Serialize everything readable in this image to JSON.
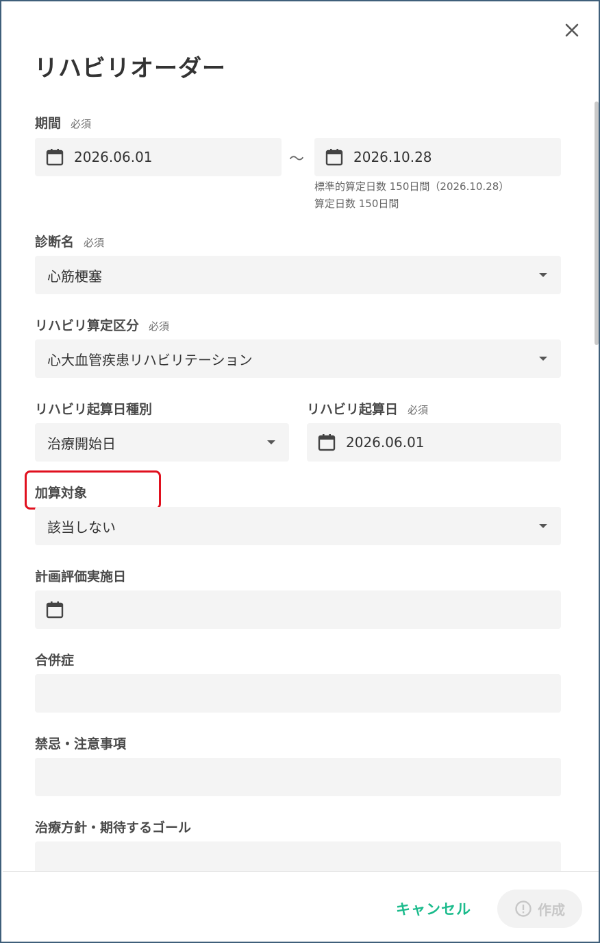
{
  "dialog": {
    "title": "リハビリオーダー",
    "close_icon": "close-icon"
  },
  "form": {
    "required_label": "必須",
    "period": {
      "label": "期間",
      "start": "2026.06.01",
      "separator": "～",
      "end": "2026.10.28",
      "standard_days_note": "標準的算定日数 150日間（2026.10.28）",
      "calc_days_note": "算定日数 150日間"
    },
    "diagnosis": {
      "label": "診断名",
      "value": "心筋梗塞"
    },
    "rehab_category": {
      "label": "リハビリ算定区分",
      "value": "心大血管疾患リハビリテーション"
    },
    "start_type": {
      "label": "リハビリ起算日種別",
      "value": "治療開始日"
    },
    "start_date": {
      "label": "リハビリ起算日",
      "value": "2026.06.01"
    },
    "addition_target": {
      "label": "加算対象",
      "value": "該当しない"
    },
    "plan_eval_date": {
      "label": "計画評価実施日",
      "value": ""
    },
    "complications": {
      "label": "合併症",
      "value": ""
    },
    "contraindications": {
      "label": "禁忌・注意事項",
      "value": ""
    },
    "treatment_goal": {
      "label": "治療方針・期待するゴール",
      "value": ""
    }
  },
  "footer": {
    "cancel_label": "キャンセル",
    "create_label": "作成"
  },
  "colors": {
    "accent": "#1bbb8c",
    "highlight": "#e0101e",
    "field_bg": "#f4f4f4",
    "disabled": "#c7c7c7"
  }
}
